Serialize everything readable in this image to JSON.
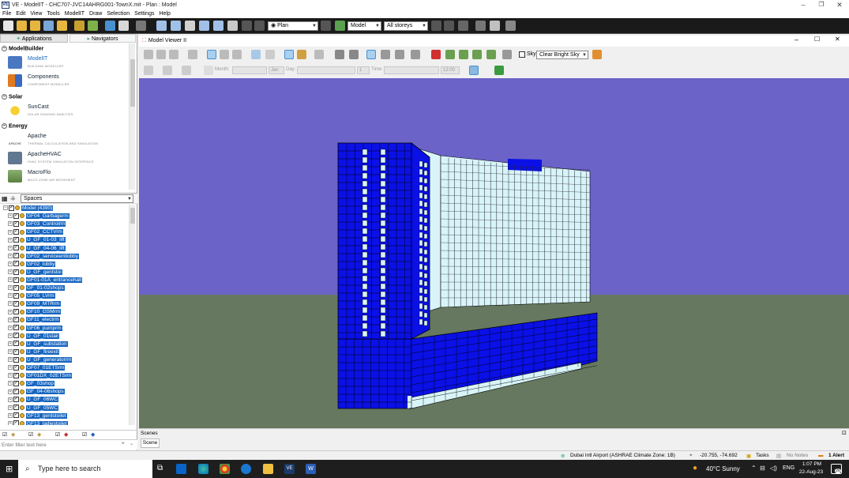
{
  "window": {
    "title": "VE - ModelIT - CHC707-JVC14AHRG001-TownX.mit - Plan : Model",
    "app_icon": "VE",
    "controls": [
      "minimize-icon",
      "restore-icon",
      "close-icon"
    ]
  },
  "menu": [
    "File",
    "Edit",
    "View",
    "Tools",
    "ModelIT",
    "Draw",
    "Selection",
    "Settings",
    "Help"
  ],
  "toolbar": {
    "view_combo": "Plan",
    "model_combo": "Model",
    "storey_combo": "All storeys"
  },
  "left_panel": {
    "tabs": {
      "applications": "Applications",
      "navigators": "Navigators"
    },
    "categories": {
      "modelbuilder": "ModelBuilder",
      "solar": "Solar",
      "energy": "Energy"
    },
    "apps": {
      "modelit": {
        "name": "ModelIT",
        "sub": "BUILDING MODELLER"
      },
      "components": {
        "name": "Components",
        "sub": "COMPONENT MODELLER"
      },
      "suncast": {
        "name": "SunCast",
        "sub": "SOLAR SHADING ANALYSIS"
      },
      "apache": {
        "name": "Apache",
        "sub": "THERMAL CALCULATION AND SIMULATION",
        "logo_text": "APACHE"
      },
      "apachehvac": {
        "name": "ApacheHVAC",
        "sub": "HVAC SYSTEM SIMULATION INTERFACE"
      },
      "macroflo": {
        "name": "MacroFlo",
        "sub": "MULTI-ZONE AIR MOVEMENT"
      }
    },
    "spaces_combo": "Spaces",
    "root": "Model (4390)",
    "spaces": [
      "GF04_Garbagerm",
      "GF03_Controlrm",
      "GF02_CCTVrm",
      "U_GF_01-03_lift",
      "U_GF_04-06_lift",
      "GF02_serviceentlobby",
      "GF02_lobby",
      "U_GF_gentstoi",
      "GF01-01A_entrancehall",
      "GF_01-02shops",
      "GF05_LVrm",
      "GF09_MTRrm",
      "GF10_GSMrm",
      "GF11_electrm",
      "GF06_pumprm",
      "U_GF_01stair",
      "U_GF_substation",
      "U_GF_fireexit",
      "U_GF_generatorrm",
      "GF07_01ETSrm",
      "GF01DX_02ETSrm",
      "GF_03shop",
      "GF_04-06shops",
      "U_GF_06WC",
      "U_GF_05WC",
      "GF13_gentstoilet",
      "GF13_ladiestoilet"
    ],
    "filter_placeholder": "Enter filter text here"
  },
  "viewer": {
    "title": "Model Viewer II",
    "sky_label": "Sky",
    "sky_value": "Clear Bright Sky",
    "month_label": "Month:",
    "month_value": "Jan",
    "day_label": "Day:",
    "day_value": "1",
    "time_label": "Time:",
    "time_value": "12:00",
    "scenes_label": "Scenes",
    "scene_tab": "Scene"
  },
  "status": {
    "location": "Dubai Intl Airport (ASHRAE Climate Zone: 1B)",
    "coords": "-20.755, -74.692",
    "tasks": "Tasks",
    "notes": "No Notes",
    "alerts": "1 Alert"
  },
  "taskbar": {
    "search_placeholder": "Type here to search",
    "weather": "40°C  Sunny",
    "lang": "ENG",
    "time": "1:07 PM",
    "date": "22-Aug-23",
    "notif_count": "26"
  },
  "colors": {
    "sky": "#6b63c8",
    "ground": "#66785f",
    "building": "#0a10e6",
    "selection": "#1565c0"
  }
}
